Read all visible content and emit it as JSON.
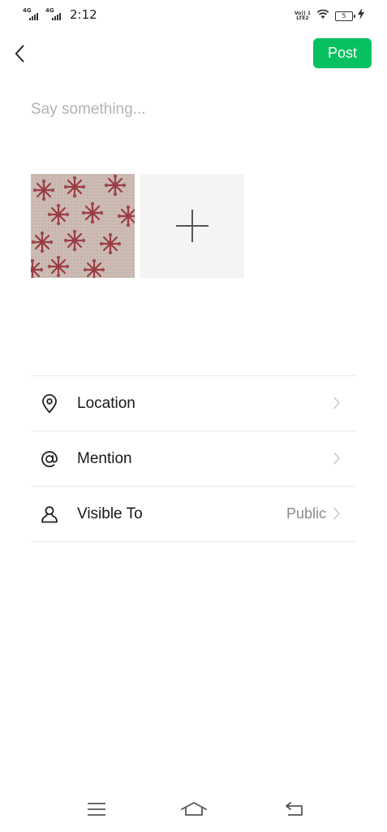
{
  "status_bar": {
    "sim1_network": "4G",
    "sim2_network": "4G",
    "time": "2:12",
    "volte_label_top": "Vo)) 1",
    "volte_label_bottom": "LTE2",
    "battery_level": "5"
  },
  "header": {
    "post_label": "Post"
  },
  "compose": {
    "placeholder": "Say something..."
  },
  "options": [
    {
      "label": "Location",
      "value": "",
      "icon": "location-pin-icon"
    },
    {
      "label": "Mention",
      "value": "",
      "icon": "at-sign-icon"
    },
    {
      "label": "Visible To",
      "value": "Public",
      "icon": "person-icon"
    }
  ],
  "colors": {
    "accent": "#07c160",
    "placeholder": "#b3b3b3",
    "divider": "#e8e8e8"
  }
}
